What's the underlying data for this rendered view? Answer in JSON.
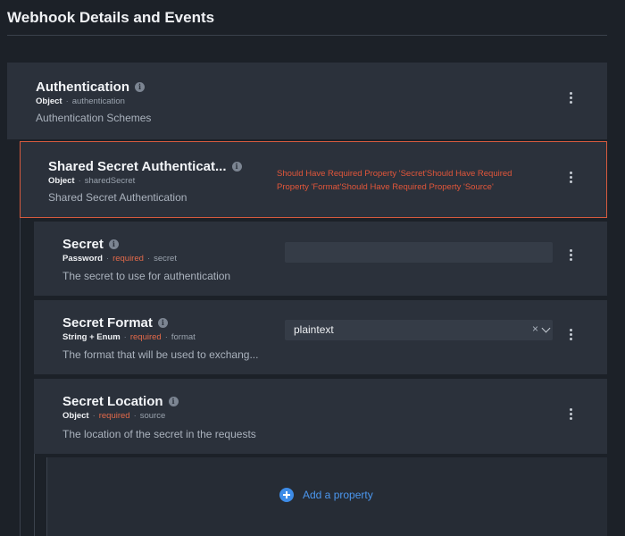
{
  "page": {
    "title": "Webhook Details and Events"
  },
  "authentication": {
    "title": "Authentication",
    "type": "Object",
    "key": "authentication",
    "description": "Authentication Schemes"
  },
  "shared_secret": {
    "title": "Shared Secret Authenticat...",
    "type": "Object",
    "key": "sharedSecret",
    "description": "Shared Secret Authentication",
    "error": "Should Have Required Property 'Secret'Should Have Required Property 'Format'Should Have Required Property 'Source'"
  },
  "secret": {
    "title": "Secret",
    "type": "Password",
    "required": "required",
    "key": "secret",
    "description": "The secret to use for authentication",
    "value": ""
  },
  "secret_format": {
    "title": "Secret Format",
    "type": "String + Enum",
    "required": "required",
    "key": "format",
    "description": "The format that will be used to exchang...",
    "selected": "plaintext",
    "clear_symbol": "×"
  },
  "secret_location": {
    "title": "Secret Location",
    "type": "Object",
    "required": "required",
    "key": "source",
    "description": "The location of the secret in the requests"
  },
  "add_property": {
    "label": "Add a property"
  },
  "icons": {
    "info": "info-icon",
    "kebab": "kebab-menu-icon",
    "add": "plus-circle-icon",
    "chevron": "chevron-down-icon"
  },
  "colors": {
    "background": "#1c2128",
    "card": "#2b313b",
    "error": "#e2563a",
    "accent": "#3d8ce8",
    "required": "#e46a4a"
  }
}
